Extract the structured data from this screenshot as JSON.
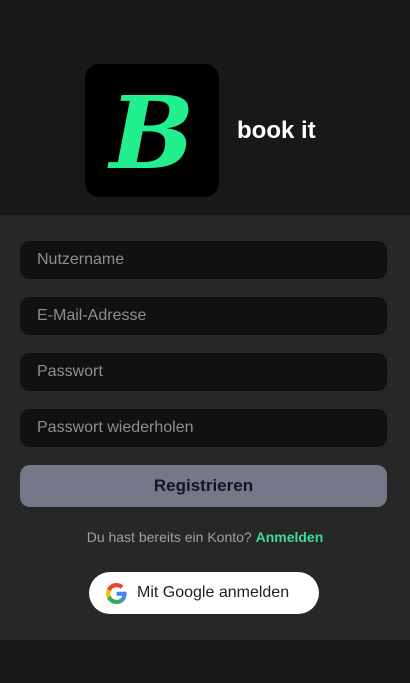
{
  "brand": {
    "app_name": "book it",
    "logo_letter": "B",
    "accent_color": "#22f08f"
  },
  "form": {
    "username_placeholder": "Nutzername",
    "email_placeholder": "E-Mail-Adresse",
    "password_placeholder": "Passwort",
    "password_repeat_placeholder": "Passwort wiederholen",
    "register_label": "Registrieren",
    "login_prompt": "Du hast bereits ein Konto?",
    "login_link": "Anmelden",
    "google_label": "Mit Google anmelden",
    "google_icon": "google-g-icon"
  },
  "colors": {
    "background": "#181818",
    "panel": "#272727",
    "input_bg": "#111111",
    "register_button": "#747889",
    "link": "#3ddc97"
  }
}
